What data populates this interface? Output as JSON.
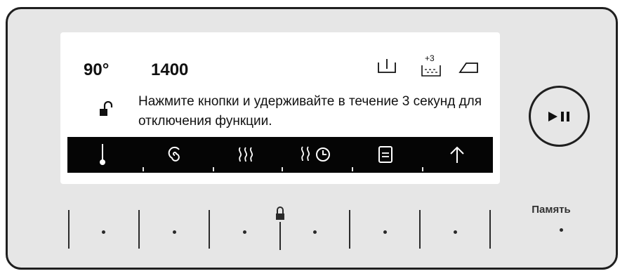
{
  "display": {
    "temperature": "90°",
    "spin_speed": "1400",
    "status_icons": [
      "prewash-tub-icon",
      "extra-rinse-icon",
      "iron-icon"
    ],
    "extra_rinse_badge": "+3",
    "lock_icon": "unlocked-padlock-icon",
    "message": "Нажмите кнопки и удерживайте в течение 3 секунд для отключения функции."
  },
  "program_bar": {
    "icons": [
      "thermometer-icon",
      "spiral-icon",
      "steam-icon",
      "steam-timer-icon",
      "document-icon",
      "arrow-up-icon"
    ]
  },
  "buttons": {
    "memory_label": "Память",
    "play_pause_icon": "play-pause-icon"
  },
  "colors": {
    "panel_bg": "#e6e6e6",
    "screen_bg": "#ffffff",
    "bar_bg": "#050505",
    "border": "#1f1f1f"
  }
}
